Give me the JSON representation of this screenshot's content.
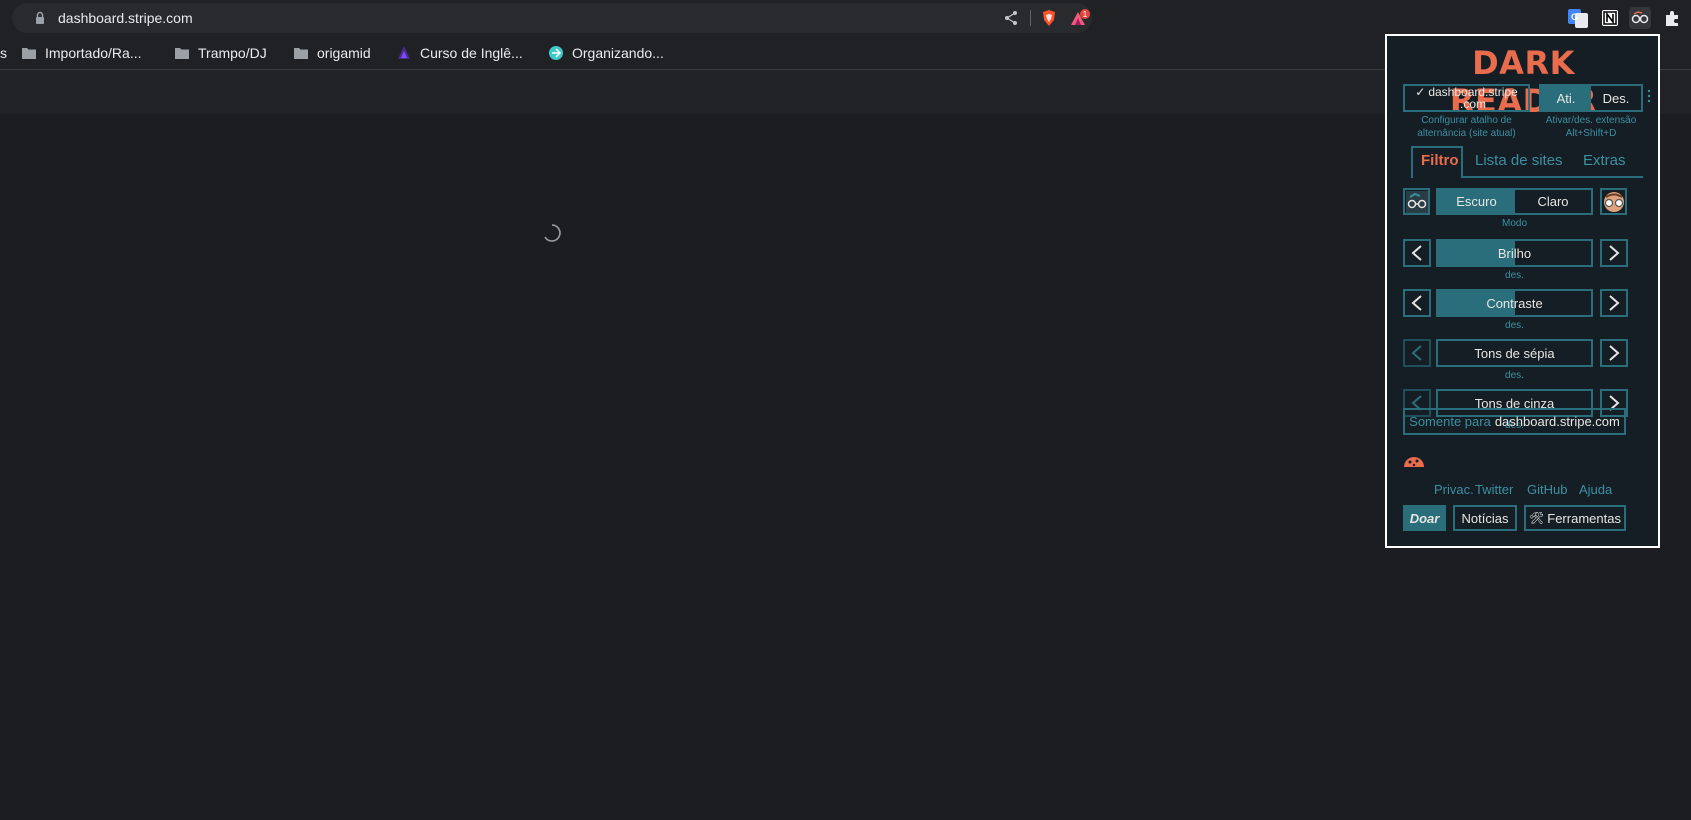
{
  "browser": {
    "url": "dashboard.stripe.com",
    "brave_badge_count": "1"
  },
  "bookmarks": [
    {
      "label": "s"
    },
    {
      "label": "Importado/Ra..."
    },
    {
      "label": "Trampo/DJ"
    },
    {
      "label": "origamid"
    },
    {
      "label": "Curso de Inglê..."
    },
    {
      "label": "Organizando..."
    }
  ],
  "dark_reader": {
    "title": "DARK READER",
    "site_toggle": {
      "label": "dashboard.stripe\n.com",
      "check": "✓",
      "caption": "Configurar atalho de alternância (site atual)"
    },
    "ext_toggle": {
      "on": "Ati.",
      "off": "Des.",
      "caption": "Ativar/des. extensão\nAlt+Shift+D"
    },
    "tabs": [
      "Filtro",
      "Lista de sites",
      "Extras"
    ],
    "mode": {
      "dark": "Escuro",
      "light": "Claro",
      "caption": "Modo"
    },
    "sliders": [
      {
        "label": "Brilho",
        "caption": "des.",
        "fill": 0.5
      },
      {
        "label": "Contraste",
        "caption": "des.",
        "fill": 0.5
      },
      {
        "label": "Tons de sépia",
        "caption": "des.",
        "fill": 0
      },
      {
        "label": "Tons de cinza",
        "caption": "des.",
        "fill": 0
      }
    ],
    "only_for": {
      "prefix": "Somente para",
      "site": "dashboard.stripe.com"
    },
    "links": [
      "Privac.",
      "Twitter",
      "GitHub",
      "Ajuda"
    ],
    "buttons": {
      "donate": "Doar",
      "news": "Notícias",
      "tools": "Ferramentas",
      "tools_icon": "🛠"
    },
    "colors": {
      "accent": "#2a6e7c",
      "title": "#e96c4c",
      "bg": "#141e24"
    }
  }
}
